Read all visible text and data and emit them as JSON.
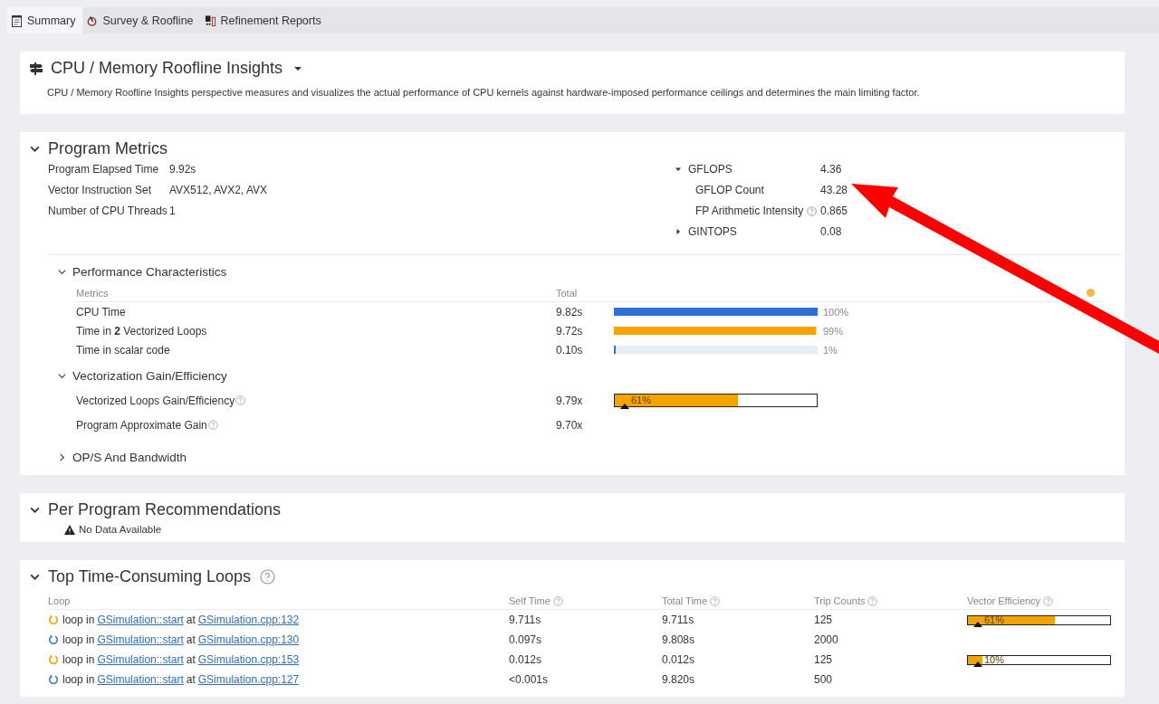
{
  "tabs": [
    {
      "label": "Summary",
      "selected": true
    },
    {
      "label": "Survey & Roofline",
      "selected": false
    },
    {
      "label": "Refinement Reports",
      "selected": false
    }
  ],
  "insights": {
    "title": "CPU / Memory Roofline Insights",
    "description": "CPU / Memory Roofline Insights perspective measures and visualizes the actual performance of CPU kernels against hardware-imposed performance ceilings and determines the main limiting factor."
  },
  "program_metrics": {
    "title": "Program Metrics",
    "expanded": true,
    "left": [
      {
        "label": "Program Elapsed Time",
        "value": "9.92s"
      },
      {
        "label": "Vector Instruction Set",
        "value": "AVX512, AVX2, AVX"
      },
      {
        "label": "Number of CPU Threads",
        "value": "1"
      }
    ],
    "right": [
      {
        "label": "GFLOPS",
        "value": "4.36",
        "kind": "group",
        "expanded": true,
        "help": false
      },
      {
        "label": "GFLOP Count",
        "value": "43.28",
        "kind": "child",
        "help": false
      },
      {
        "label": "FP Arithmetic Intensity",
        "value": "0.865",
        "kind": "child",
        "help": true
      },
      {
        "label": "GINTOPS",
        "value": "0.08",
        "kind": "group",
        "expanded": false,
        "help": false
      }
    ]
  },
  "performance": {
    "title": "Performance Characteristics",
    "expanded": true,
    "columns": [
      "Metrics",
      "Total"
    ],
    "rows": [
      {
        "label": "CPU Time",
        "value": "9.82s",
        "level": 1.0,
        "percent": "100%",
        "color": "#2f6fd6"
      },
      {
        "label": "Time in **2** Vectorized Loops",
        "value": "9.72s",
        "level": 0.99,
        "percent": "99%",
        "color": "#f5a300"
      },
      {
        "label": "Time in scalar code",
        "value": "0.10s",
        "level": 0.01,
        "percent": "1%",
        "color": "#2f6fd6"
      }
    ]
  },
  "vectorization": {
    "title": "Vectorization Gain/Efficiency",
    "expanded": true,
    "rows": [
      {
        "label": "Vectorized Loops Gain/Efficiency",
        "value": "9.79x",
        "efficiency": {
          "level": 0.61,
          "label": "61%"
        }
      },
      {
        "label": "Program Approximate Gain",
        "value": "9.70x"
      }
    ]
  },
  "ops": {
    "title": "OP/S And Bandwidth",
    "expanded": false
  },
  "recommendations": {
    "title": "Per Program Recommendations",
    "expanded": true,
    "message": "No Data Available"
  },
  "loops": {
    "title": "Top Time-Consuming Loops",
    "expanded": true,
    "columns": [
      {
        "label": "Loop",
        "help": false
      },
      {
        "label": "Self Time",
        "help": true
      },
      {
        "label": "Total Time",
        "help": true
      },
      {
        "label": "Trip Counts",
        "help": true
      },
      {
        "label": "Vector Efficiency",
        "help": true
      }
    ],
    "rows": [
      {
        "color": "#f5a300",
        "prefix": "loop in",
        "function": "GSimulation::start",
        "middle": "at",
        "file": "GSimulation.cpp:132",
        "self_time": "9.711s",
        "total_time": "9.711s",
        "trip_counts": "125",
        "efficiency": {
          "level": 0.61,
          "label": "61%"
        }
      },
      {
        "color": "#2f7fc8",
        "prefix": "loop in",
        "function": "GSimulation::start",
        "middle": "at",
        "file": "GSimulation.cpp:130",
        "self_time": "0.097s",
        "total_time": "9.808s",
        "trip_counts": "2000"
      },
      {
        "color": "#f5a300",
        "prefix": "loop in",
        "function": "GSimulation::start",
        "middle": "at",
        "file": "GSimulation.cpp:153",
        "self_time": "0.012s",
        "total_time": "0.012s",
        "trip_counts": "125",
        "efficiency": {
          "level": 0.1,
          "label": "10%"
        }
      },
      {
        "color": "#2f7fc8",
        "prefix": "loop in",
        "function": "GSimulation::start",
        "middle": "at",
        "file": "GSimulation.cpp:127",
        "self_time": "<0.001s",
        "total_time": "9.820s",
        "trip_counts": "500"
      }
    ]
  }
}
